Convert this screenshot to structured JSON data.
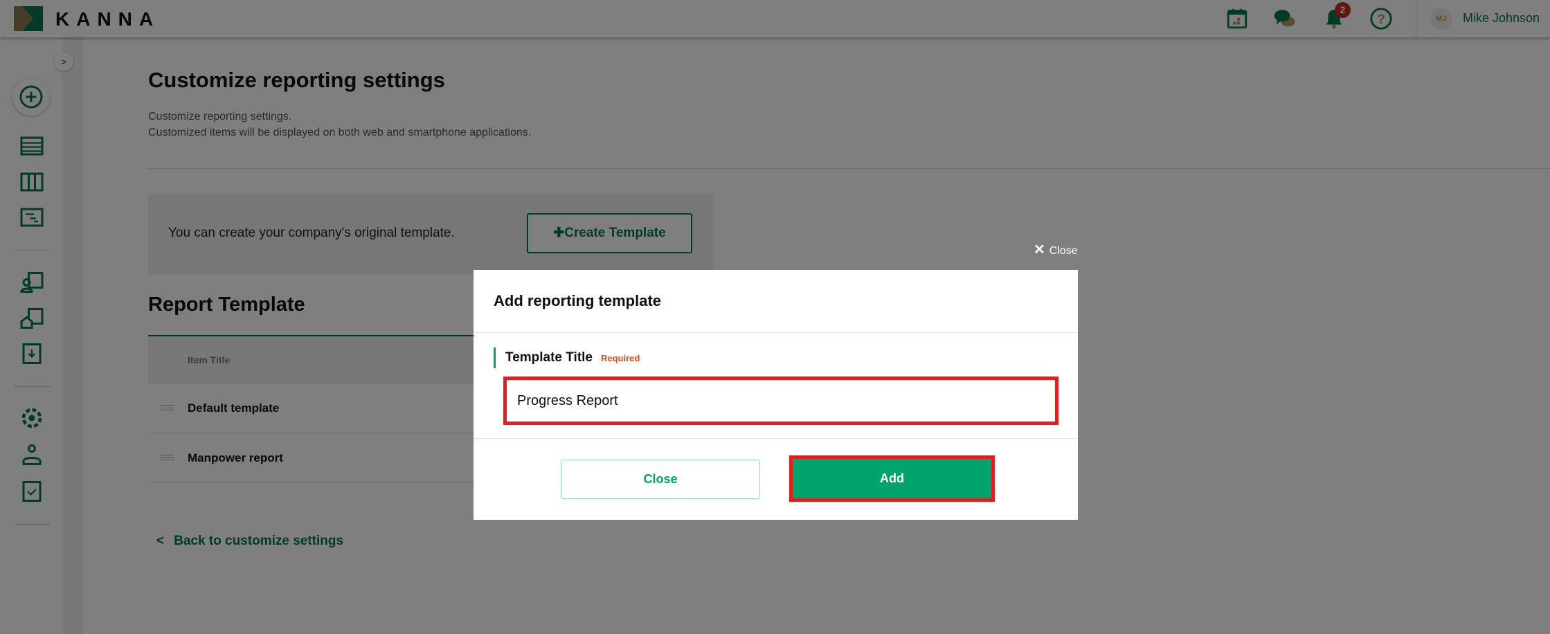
{
  "header": {
    "brand": "KANNA",
    "notification_count": "2",
    "user_initials": "MJ",
    "user_name": "Mike Johnson"
  },
  "sidebar": {
    "expand_label": ">"
  },
  "page": {
    "title": "Customize reporting settings",
    "description_lines": [
      "Customize reporting settings.",
      "Customized items will be displayed on both web and smartphone applications."
    ],
    "card_text": "You can create your company's original template.",
    "create_button": "Create Template",
    "section_title": "Report Template",
    "table": {
      "header": "Item Title",
      "rows": [
        "Default template",
        "Manpower report"
      ]
    },
    "back_link": "Back to customize settings"
  },
  "modal": {
    "close_label": "Close",
    "title": "Add reporting template",
    "field_label": "Template Title",
    "required_badge": "Required",
    "field_value": "Progress Report",
    "cancel_button": "Close",
    "add_button": "Add"
  },
  "colors": {
    "brand": "#00774a",
    "primary": "#00a36c",
    "required": "#e8471c",
    "highlight": "#e41e1e"
  }
}
